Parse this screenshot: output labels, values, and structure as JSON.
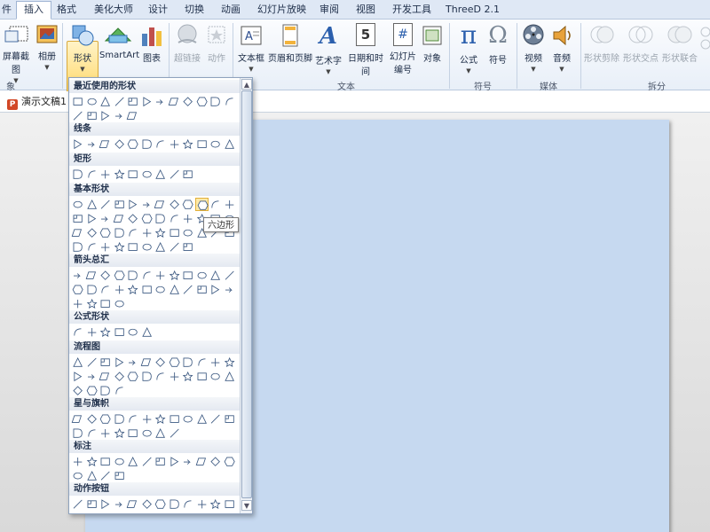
{
  "ribbon_tabs": [
    {
      "label": "件",
      "active": false
    },
    {
      "label": "插入",
      "active": true
    },
    {
      "label": "格式",
      "active": false
    },
    {
      "label": "美化大师",
      "active": false
    },
    {
      "label": "设计",
      "active": false
    },
    {
      "label": "切换",
      "active": false
    },
    {
      "label": "动画",
      "active": false
    },
    {
      "label": "幻灯片放映",
      "active": false
    },
    {
      "label": "审阅",
      "active": false
    },
    {
      "label": "视图",
      "active": false
    },
    {
      "label": "开发工具",
      "active": false
    },
    {
      "label": "ThreeD 2.1",
      "active": false
    }
  ],
  "ribbon": {
    "screenshot_label": "屏幕截图",
    "album_label": "相册",
    "shapes_label": "形状",
    "smartart_label": "SmartArt",
    "chart_label": "图表",
    "hyperlink_label": "超链接",
    "action_label": "动作",
    "textbox_label": "文本框",
    "header_footer_label": "页眉和页脚",
    "wordart_label": "艺术字",
    "datetime_label": "日期和时间",
    "slide_number_label_1": "幻灯片",
    "slide_number_label_2": "编号",
    "object_label": "对象",
    "equation_label": "公式",
    "symbol_label": "符号",
    "video_label": "视频",
    "audio_label": "音频",
    "shape_cut_label": "形状剪除",
    "shape_intersect_label": "形状交点",
    "shape_union_label": "形状联合",
    "group_images_label": "象",
    "group_text_label": "文本",
    "group_symbols_label": "符号",
    "group_media_label": "媒体",
    "group_split_label": "拆分",
    "equation_glyph": "π",
    "symbol_glyph": "Ω",
    "wordart_glyph": "A",
    "datetime_glyph": "5",
    "slide_number_glyph": "#"
  },
  "document": {
    "tab_label": "演示文稿1"
  },
  "gallery": {
    "sections": [
      {
        "title": "最近使用的形状",
        "rows": [
          12,
          5
        ]
      },
      {
        "title": "线条",
        "rows": [
          12
        ]
      },
      {
        "title": "矩形",
        "rows": [
          9
        ]
      },
      {
        "title": "基本形状",
        "rows": [
          12,
          12,
          12,
          9
        ]
      },
      {
        "title": "箭头总汇",
        "rows": [
          12,
          12,
          4
        ]
      },
      {
        "title": "公式形状",
        "rows": [
          6
        ]
      },
      {
        "title": "流程图",
        "rows": [
          12,
          12,
          4
        ]
      },
      {
        "title": "星与旗帜",
        "rows": [
          12,
          8
        ]
      },
      {
        "title": "标注",
        "rows": [
          12,
          4
        ]
      },
      {
        "title": "动作按钮",
        "rows": [
          12
        ]
      }
    ],
    "tooltip": "六边形"
  },
  "colors": {
    "slide": "#c6d9f0",
    "accent": "#2b579a",
    "highlight": "#fde9a8"
  }
}
